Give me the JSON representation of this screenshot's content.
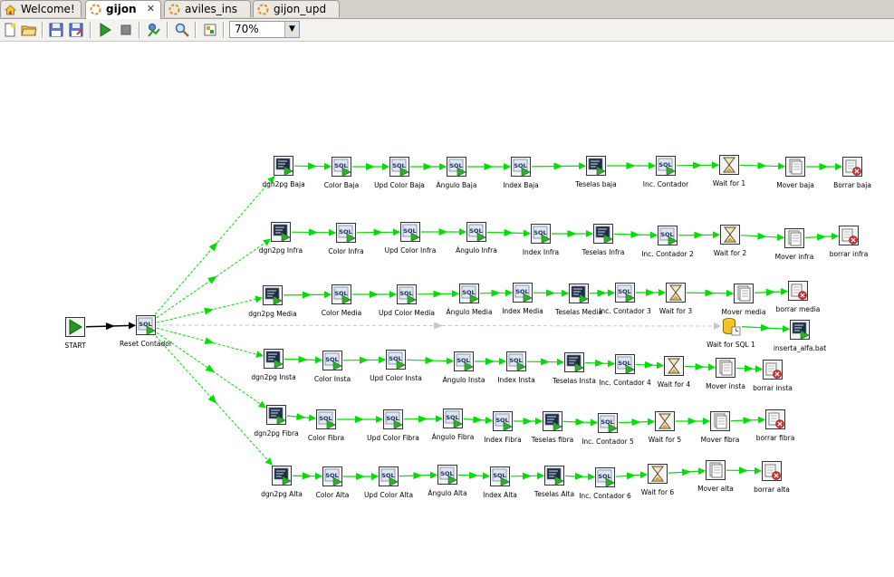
{
  "tabs": [
    {
      "label": "Welcome!",
      "icon": "home-icon",
      "active": false
    },
    {
      "label": "gijon",
      "icon": "job-icon",
      "active": true,
      "close": "✕"
    },
    {
      "label": "aviles_ins",
      "icon": "job-icon",
      "active": false
    },
    {
      "label": "gijon_upd",
      "icon": "job-icon",
      "active": false
    }
  ],
  "toolbar": {
    "buttons": [
      "new-icon",
      "open-icon",
      "save-icon",
      "save-as-icon",
      "run-icon",
      "stop-icon",
      "preview-icon",
      "explore-icon",
      "grid-icon"
    ],
    "zoom": "70%"
  },
  "colors": {
    "hop": "#00dd00",
    "hop_disabled": "#c8c8c8",
    "start": "#1f9a1f"
  },
  "nodes": [
    {
      "id": "start",
      "label": "START",
      "type": "start"
    },
    {
      "id": "reset",
      "label": "Reset Contador",
      "type": "sql"
    },
    {
      "id": "b1",
      "label": "dgn2pg Baja",
      "type": "shell"
    },
    {
      "id": "b2",
      "label": "Color Baja",
      "type": "sql"
    },
    {
      "id": "b3",
      "label": "Upd Color Baja",
      "type": "sql"
    },
    {
      "id": "b4",
      "label": "Ángulo Baja",
      "type": "sql"
    },
    {
      "id": "b5",
      "label": "Index Baja",
      "type": "sql"
    },
    {
      "id": "b6",
      "label": "Teselas baja",
      "type": "shell"
    },
    {
      "id": "b7",
      "label": "Inc. Contador",
      "type": "sql"
    },
    {
      "id": "b8",
      "label": "Wait for 1",
      "type": "wait"
    },
    {
      "id": "b9",
      "label": "Mover baja",
      "type": "move"
    },
    {
      "id": "b10",
      "label": "Borrar baja",
      "type": "delete"
    },
    {
      "id": "i1",
      "label": "dgn2pg Infra",
      "type": "shell"
    },
    {
      "id": "i2",
      "label": "Color Infra",
      "type": "sql"
    },
    {
      "id": "i3",
      "label": "Upd Color Infra",
      "type": "sql"
    },
    {
      "id": "i4",
      "label": "Ángulo Infra",
      "type": "sql"
    },
    {
      "id": "i5",
      "label": "Index Infra",
      "type": "sql"
    },
    {
      "id": "i6",
      "label": "Teselas Infra",
      "type": "shell"
    },
    {
      "id": "i7",
      "label": "Inc. Contador 2",
      "type": "sql"
    },
    {
      "id": "i8",
      "label": "Wait for 2",
      "type": "wait"
    },
    {
      "id": "i9",
      "label": "Mover infra",
      "type": "move"
    },
    {
      "id": "i10",
      "label": "borrar infra",
      "type": "delete"
    },
    {
      "id": "m1",
      "label": "dgn2pg Media",
      "type": "shell"
    },
    {
      "id": "m2",
      "label": "Color Media",
      "type": "sql"
    },
    {
      "id": "m3",
      "label": "Upd Color Media",
      "type": "sql"
    },
    {
      "id": "m4",
      "label": "Ángulo Media",
      "type": "sql"
    },
    {
      "id": "m5",
      "label": "Index Media",
      "type": "sql"
    },
    {
      "id": "m6",
      "label": "Teselas Media",
      "type": "shell"
    },
    {
      "id": "m7",
      "label": "Inc. Contador 3",
      "type": "sql"
    },
    {
      "id": "m8",
      "label": "Wait for 3",
      "type": "wait"
    },
    {
      "id": "m9",
      "label": "Mover media",
      "type": "move"
    },
    {
      "id": "m10",
      "label": "borrar media",
      "type": "delete"
    },
    {
      "id": "w1",
      "label": "Wait for SQL 1",
      "type": "waitsql"
    },
    {
      "id": "w2",
      "label": "inserta_alfa.bat",
      "type": "shell"
    },
    {
      "id": "n1",
      "label": "dgn2pg Insta",
      "type": "shell"
    },
    {
      "id": "n2",
      "label": "Color Insta",
      "type": "sql"
    },
    {
      "id": "n3",
      "label": "Upd Color Insta",
      "type": "sql"
    },
    {
      "id": "n4",
      "label": "Ángulo Insta",
      "type": "sql"
    },
    {
      "id": "n5",
      "label": "Index Insta",
      "type": "sql"
    },
    {
      "id": "n6",
      "label": "Teselas Insta",
      "type": "shell"
    },
    {
      "id": "n7",
      "label": "Inc. Contador 4",
      "type": "sql"
    },
    {
      "id": "n8",
      "label": "Wait for 4",
      "type": "wait"
    },
    {
      "id": "n9",
      "label": "Mover insta",
      "type": "move"
    },
    {
      "id": "n10",
      "label": "borrar insta",
      "type": "delete"
    },
    {
      "id": "f1",
      "label": "dgn2pg Fibra",
      "type": "shell"
    },
    {
      "id": "f2",
      "label": "Color Fibra",
      "type": "sql"
    },
    {
      "id": "f3",
      "label": "Upd Color Fibra",
      "type": "sql"
    },
    {
      "id": "f4",
      "label": "Ángulo Fibra",
      "type": "sql"
    },
    {
      "id": "f5",
      "label": "Index Fibra",
      "type": "sql"
    },
    {
      "id": "f6",
      "label": "Teselas fibra",
      "type": "shell"
    },
    {
      "id": "f7",
      "label": "Inc. Contador 5",
      "type": "sql"
    },
    {
      "id": "f8",
      "label": "Wait for 5",
      "type": "wait"
    },
    {
      "id": "f9",
      "label": "Mover fibra",
      "type": "move"
    },
    {
      "id": "f10",
      "label": "borrar fibra",
      "type": "delete"
    },
    {
      "id": "a1",
      "label": "dgn2pg Alta",
      "type": "shell"
    },
    {
      "id": "a2",
      "label": "Color Alta",
      "type": "sql"
    },
    {
      "id": "a3",
      "label": "Upd Color Alta",
      "type": "sql"
    },
    {
      "id": "a4",
      "label": "Ángulo Alta",
      "type": "sql"
    },
    {
      "id": "a5",
      "label": "Index Alta",
      "type": "sql"
    },
    {
      "id": "a6",
      "label": "Teselas Alta",
      "type": "shell"
    },
    {
      "id": "a7",
      "label": "Inc. Contador 6",
      "type": "sql"
    },
    {
      "id": "a8",
      "label": "Wait for 6",
      "type": "wait"
    },
    {
      "id": "a9",
      "label": "Mover alta",
      "type": "move"
    },
    {
      "id": "a10",
      "label": "borrar alta",
      "type": "delete"
    }
  ],
  "hops": [
    [
      "start",
      "reset",
      "unconditional"
    ],
    [
      "reset",
      "b1",
      "parallel"
    ],
    [
      "reset",
      "i1",
      "parallel"
    ],
    [
      "reset",
      "m1",
      "parallel"
    ],
    [
      "reset",
      "w1",
      "disabled"
    ],
    [
      "reset",
      "n1",
      "parallel"
    ],
    [
      "reset",
      "f1",
      "parallel"
    ],
    [
      "reset",
      "a1",
      "parallel"
    ],
    [
      "b1",
      "b2",
      "ok"
    ],
    [
      "b2",
      "b3",
      "ok"
    ],
    [
      "b3",
      "b4",
      "ok"
    ],
    [
      "b4",
      "b5",
      "ok"
    ],
    [
      "b5",
      "b6",
      "ok"
    ],
    [
      "b6",
      "b7",
      "ok"
    ],
    [
      "b7",
      "b8",
      "ok"
    ],
    [
      "b8",
      "b9",
      "ok"
    ],
    [
      "b9",
      "b10",
      "ok"
    ],
    [
      "i1",
      "i2",
      "ok"
    ],
    [
      "i2",
      "i3",
      "ok"
    ],
    [
      "i3",
      "i4",
      "ok"
    ],
    [
      "i4",
      "i5",
      "ok"
    ],
    [
      "i5",
      "i6",
      "ok"
    ],
    [
      "i6",
      "i7",
      "ok"
    ],
    [
      "i7",
      "i8",
      "ok"
    ],
    [
      "i8",
      "i9",
      "ok"
    ],
    [
      "i9",
      "i10",
      "ok"
    ],
    [
      "m1",
      "m2",
      "ok"
    ],
    [
      "m2",
      "m3",
      "ok"
    ],
    [
      "m3",
      "m4",
      "ok"
    ],
    [
      "m4",
      "m5",
      "ok"
    ],
    [
      "m5",
      "m6",
      "ok"
    ],
    [
      "m6",
      "m7",
      "ok"
    ],
    [
      "m7",
      "m8",
      "ok"
    ],
    [
      "m8",
      "m9",
      "ok"
    ],
    [
      "m9",
      "m10",
      "ok"
    ],
    [
      "w1",
      "w2",
      "ok"
    ],
    [
      "n1",
      "n2",
      "ok"
    ],
    [
      "n2",
      "n3",
      "ok"
    ],
    [
      "n3",
      "n4",
      "ok"
    ],
    [
      "n4",
      "n5",
      "ok"
    ],
    [
      "n5",
      "n6",
      "ok"
    ],
    [
      "n6",
      "n7",
      "ok"
    ],
    [
      "n7",
      "n8",
      "ok"
    ],
    [
      "n8",
      "n9",
      "ok"
    ],
    [
      "n9",
      "n10",
      "ok"
    ],
    [
      "f1",
      "f2",
      "ok"
    ],
    [
      "f2",
      "f3",
      "ok"
    ],
    [
      "f3",
      "f4",
      "ok"
    ],
    [
      "f4",
      "f5",
      "ok"
    ],
    [
      "f5",
      "f6",
      "ok"
    ],
    [
      "f6",
      "f7",
      "ok"
    ],
    [
      "f7",
      "f8",
      "ok"
    ],
    [
      "f8",
      "f9",
      "ok"
    ],
    [
      "f9",
      "f10",
      "ok"
    ],
    [
      "a1",
      "a2",
      "ok"
    ],
    [
      "a2",
      "a3",
      "ok"
    ],
    [
      "a3",
      "a4",
      "ok"
    ],
    [
      "a4",
      "a5",
      "ok"
    ],
    [
      "a5",
      "a6",
      "ok"
    ],
    [
      "a6",
      "a7",
      "ok"
    ],
    [
      "a7",
      "a8",
      "ok"
    ],
    [
      "a8",
      "a9",
      "ok"
    ],
    [
      "a9",
      "a10",
      "ok"
    ]
  ]
}
